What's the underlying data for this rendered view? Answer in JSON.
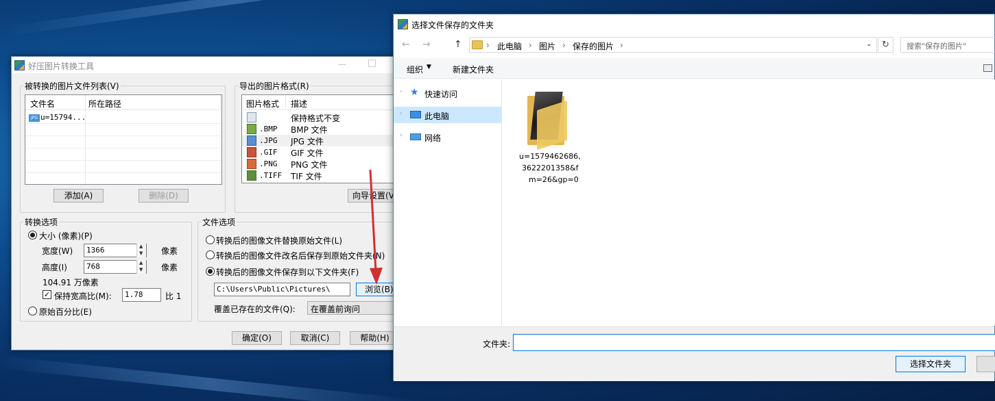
{
  "colors": {
    "accent": "#0078d7",
    "arrow": "#d32f2f"
  },
  "app": {
    "title": "好压图片转换工具",
    "file_list": {
      "legend": "被转换的图片文件列表(V)",
      "columns": [
        "文件名",
        "所在路径"
      ],
      "rows": [
        {
          "name": "u=15794...",
          "path": ""
        }
      ],
      "add_label": "添加(A)",
      "delete_label": "删除(D)"
    },
    "export_format": {
      "legend": "导出的图片格式(R)",
      "columns": [
        "图片格式",
        "描述"
      ],
      "rows": [
        {
          "format": "",
          "desc": "保持格式不变"
        },
        {
          "format": ".BMP",
          "desc": "BMP 文件"
        },
        {
          "format": ".JPG",
          "desc": "JPG 文件"
        },
        {
          "format": ".GIF",
          "desc": "GIF 文件"
        },
        {
          "format": ".PNG",
          "desc": "PNG 文件"
        },
        {
          "format": ".TIFF",
          "desc": "TIF 文件"
        }
      ],
      "wizard_label": "向导设置(V"
    },
    "convert_options": {
      "legend": "转换选项",
      "size_label": "大小 (像素)(P)",
      "width_label": "宽度(W)",
      "width_value": "1366",
      "height_label": "高度(I)",
      "height_value": "768",
      "unit": "像素",
      "megapixels": "104.91 万像素",
      "keep_ratio_label": "保持宽高比(M):",
      "ratio_value": "1.78",
      "ratio_suffix": "比 1",
      "percent_label": "原始百分比(E)"
    },
    "file_options": {
      "legend": "文件选项",
      "opt_replace": "转换后的图像文件替换原始文件(L)",
      "opt_rename": "转换后的图像文件改名后保存到原始文件夹(N)",
      "opt_folder": "转换后的图像文件保存到以下文件夹(F)",
      "folder_path": "C:\\Users\\Public\\Pictures\\",
      "browse_label": "浏览(B)",
      "overwrite_label": "覆盖已存在的文件(Q):",
      "overwrite_value": "在覆盖前询问"
    },
    "ok_label": "确定(O)",
    "cancel_label": "取消(C)",
    "help_label": "帮助(H)"
  },
  "dialog": {
    "title": "选择文件保存的文件夹",
    "breadcrumb": [
      "此电脑",
      "图片",
      "保存的图片"
    ],
    "search_placeholder": "搜索\"保存的图片\"",
    "toolbar": {
      "organize": "组织",
      "new_folder": "新建文件夹"
    },
    "nav": [
      "快速访问",
      "此电脑",
      "网络"
    ],
    "folder_item": {
      "line1": "u=1579462686,",
      "line2": "3622201358&f",
      "line3": "m=26&gp=0"
    },
    "folder_label": "文件夹:",
    "folder_value": "",
    "select_label": "选择文件夹"
  }
}
